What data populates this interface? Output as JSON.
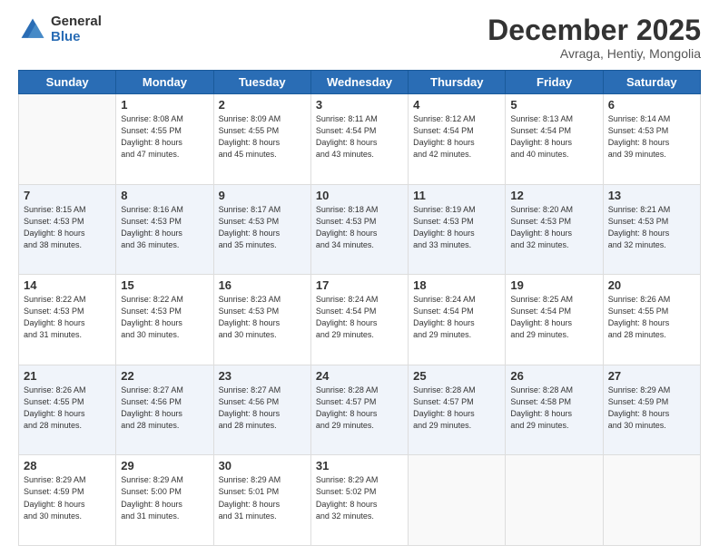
{
  "logo": {
    "general": "General",
    "blue": "Blue"
  },
  "header": {
    "month": "December 2025",
    "location": "Avraga, Hentiy, Mongolia"
  },
  "days_of_week": [
    "Sunday",
    "Monday",
    "Tuesday",
    "Wednesday",
    "Thursday",
    "Friday",
    "Saturday"
  ],
  "weeks": [
    [
      {
        "day": "",
        "info": ""
      },
      {
        "day": "1",
        "info": "Sunrise: 8:08 AM\nSunset: 4:55 PM\nDaylight: 8 hours\nand 47 minutes."
      },
      {
        "day": "2",
        "info": "Sunrise: 8:09 AM\nSunset: 4:55 PM\nDaylight: 8 hours\nand 45 minutes."
      },
      {
        "day": "3",
        "info": "Sunrise: 8:11 AM\nSunset: 4:54 PM\nDaylight: 8 hours\nand 43 minutes."
      },
      {
        "day": "4",
        "info": "Sunrise: 8:12 AM\nSunset: 4:54 PM\nDaylight: 8 hours\nand 42 minutes."
      },
      {
        "day": "5",
        "info": "Sunrise: 8:13 AM\nSunset: 4:54 PM\nDaylight: 8 hours\nand 40 minutes."
      },
      {
        "day": "6",
        "info": "Sunrise: 8:14 AM\nSunset: 4:53 PM\nDaylight: 8 hours\nand 39 minutes."
      }
    ],
    [
      {
        "day": "7",
        "info": "Sunrise: 8:15 AM\nSunset: 4:53 PM\nDaylight: 8 hours\nand 38 minutes."
      },
      {
        "day": "8",
        "info": "Sunrise: 8:16 AM\nSunset: 4:53 PM\nDaylight: 8 hours\nand 36 minutes."
      },
      {
        "day": "9",
        "info": "Sunrise: 8:17 AM\nSunset: 4:53 PM\nDaylight: 8 hours\nand 35 minutes."
      },
      {
        "day": "10",
        "info": "Sunrise: 8:18 AM\nSunset: 4:53 PM\nDaylight: 8 hours\nand 34 minutes."
      },
      {
        "day": "11",
        "info": "Sunrise: 8:19 AM\nSunset: 4:53 PM\nDaylight: 8 hours\nand 33 minutes."
      },
      {
        "day": "12",
        "info": "Sunrise: 8:20 AM\nSunset: 4:53 PM\nDaylight: 8 hours\nand 32 minutes."
      },
      {
        "day": "13",
        "info": "Sunrise: 8:21 AM\nSunset: 4:53 PM\nDaylight: 8 hours\nand 32 minutes."
      }
    ],
    [
      {
        "day": "14",
        "info": "Sunrise: 8:22 AM\nSunset: 4:53 PM\nDaylight: 8 hours\nand 31 minutes."
      },
      {
        "day": "15",
        "info": "Sunrise: 8:22 AM\nSunset: 4:53 PM\nDaylight: 8 hours\nand 30 minutes."
      },
      {
        "day": "16",
        "info": "Sunrise: 8:23 AM\nSunset: 4:53 PM\nDaylight: 8 hours\nand 30 minutes."
      },
      {
        "day": "17",
        "info": "Sunrise: 8:24 AM\nSunset: 4:54 PM\nDaylight: 8 hours\nand 29 minutes."
      },
      {
        "day": "18",
        "info": "Sunrise: 8:24 AM\nSunset: 4:54 PM\nDaylight: 8 hours\nand 29 minutes."
      },
      {
        "day": "19",
        "info": "Sunrise: 8:25 AM\nSunset: 4:54 PM\nDaylight: 8 hours\nand 29 minutes."
      },
      {
        "day": "20",
        "info": "Sunrise: 8:26 AM\nSunset: 4:55 PM\nDaylight: 8 hours\nand 28 minutes."
      }
    ],
    [
      {
        "day": "21",
        "info": "Sunrise: 8:26 AM\nSunset: 4:55 PM\nDaylight: 8 hours\nand 28 minutes."
      },
      {
        "day": "22",
        "info": "Sunrise: 8:27 AM\nSunset: 4:56 PM\nDaylight: 8 hours\nand 28 minutes."
      },
      {
        "day": "23",
        "info": "Sunrise: 8:27 AM\nSunset: 4:56 PM\nDaylight: 8 hours\nand 28 minutes."
      },
      {
        "day": "24",
        "info": "Sunrise: 8:28 AM\nSunset: 4:57 PM\nDaylight: 8 hours\nand 29 minutes."
      },
      {
        "day": "25",
        "info": "Sunrise: 8:28 AM\nSunset: 4:57 PM\nDaylight: 8 hours\nand 29 minutes."
      },
      {
        "day": "26",
        "info": "Sunrise: 8:28 AM\nSunset: 4:58 PM\nDaylight: 8 hours\nand 29 minutes."
      },
      {
        "day": "27",
        "info": "Sunrise: 8:29 AM\nSunset: 4:59 PM\nDaylight: 8 hours\nand 30 minutes."
      }
    ],
    [
      {
        "day": "28",
        "info": "Sunrise: 8:29 AM\nSunset: 4:59 PM\nDaylight: 8 hours\nand 30 minutes."
      },
      {
        "day": "29",
        "info": "Sunrise: 8:29 AM\nSunset: 5:00 PM\nDaylight: 8 hours\nand 31 minutes."
      },
      {
        "day": "30",
        "info": "Sunrise: 8:29 AM\nSunset: 5:01 PM\nDaylight: 8 hours\nand 31 minutes."
      },
      {
        "day": "31",
        "info": "Sunrise: 8:29 AM\nSunset: 5:02 PM\nDaylight: 8 hours\nand 32 minutes."
      },
      {
        "day": "",
        "info": ""
      },
      {
        "day": "",
        "info": ""
      },
      {
        "day": "",
        "info": ""
      }
    ]
  ]
}
